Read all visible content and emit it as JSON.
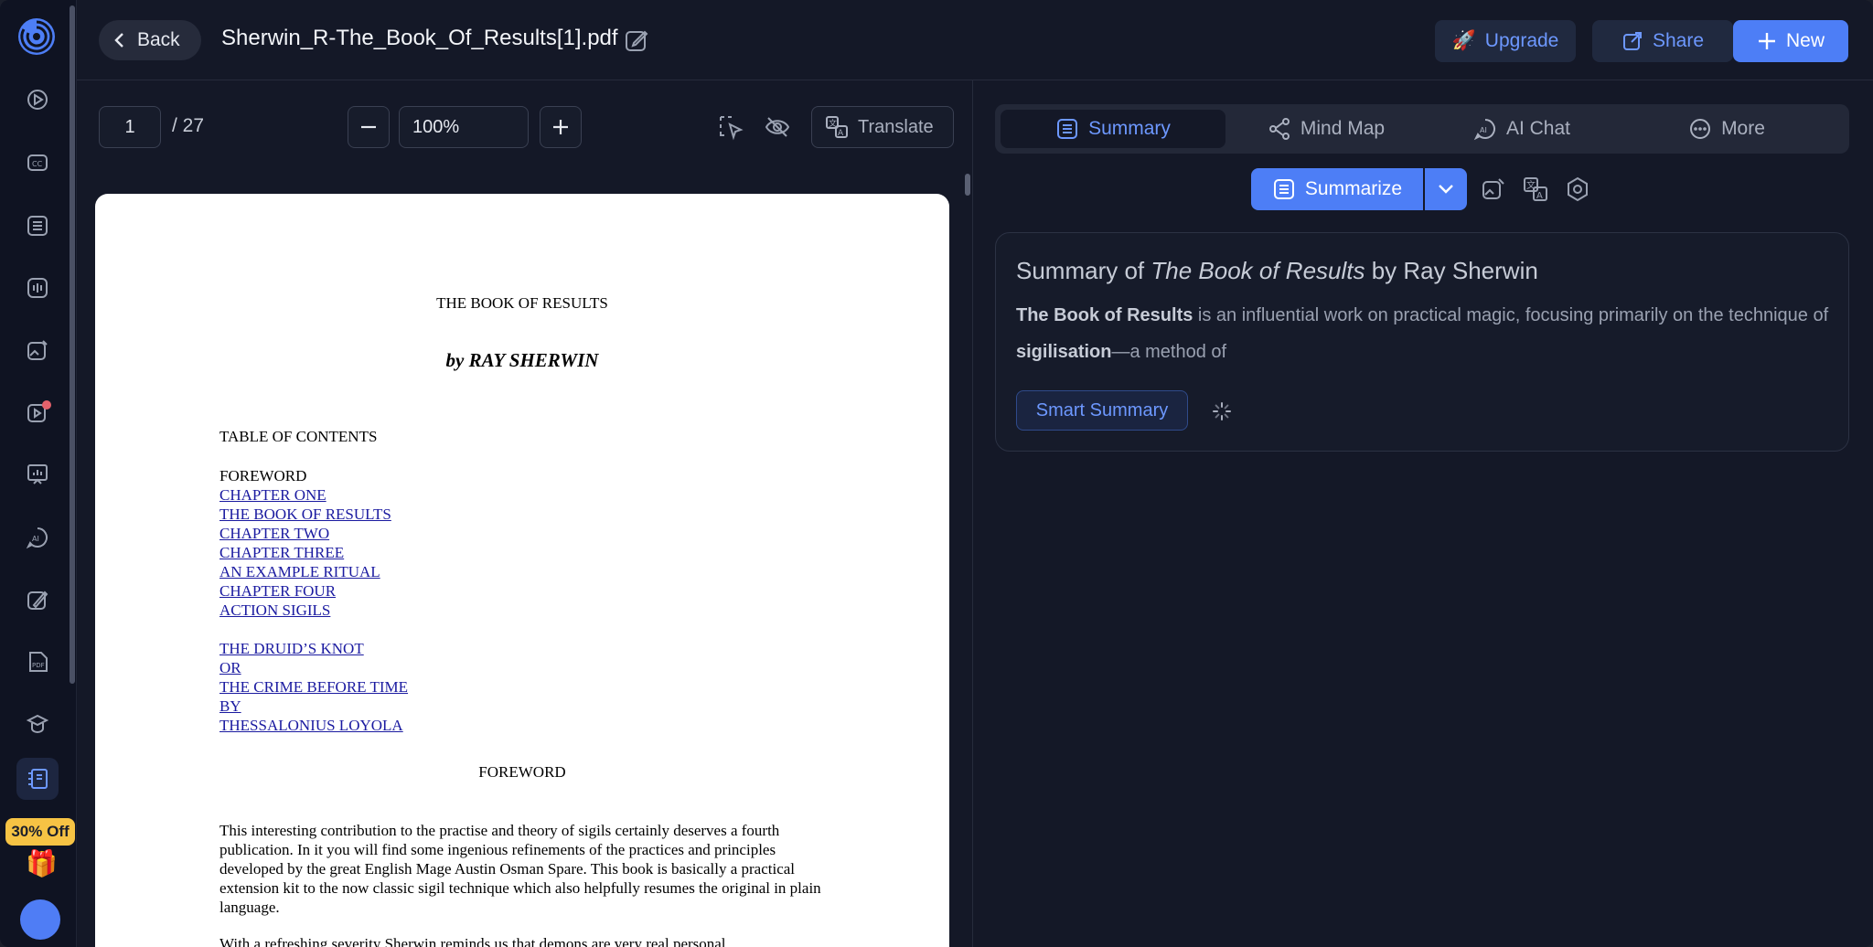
{
  "header": {
    "back_label": "Back",
    "doc_title": "Sherwin_R-The_Book_Of_Results[1].pdf",
    "upgrade_label": "Upgrade",
    "share_label": "Share",
    "new_label": "New"
  },
  "sidebar": {
    "promo_label": "30% Off",
    "items": [
      {
        "icon": "video-icon"
      },
      {
        "icon": "captions-icon"
      },
      {
        "icon": "list-icon"
      },
      {
        "icon": "audio-wave-icon"
      },
      {
        "icon": "image-edit-icon"
      },
      {
        "icon": "video-ai-icon"
      },
      {
        "icon": "presentation-icon"
      },
      {
        "icon": "ai-chat-icon"
      },
      {
        "icon": "pen-icon"
      },
      {
        "icon": "pdf-icon"
      },
      {
        "icon": "graduation-icon"
      },
      {
        "icon": "book-icon"
      }
    ]
  },
  "pdf_toolbar": {
    "page_current": "1",
    "page_total": "/ 27",
    "zoom": "100%",
    "translate_label": "Translate"
  },
  "pdf_page": {
    "title": "THE BOOK OF RESULTS",
    "byline": "by RAY SHERWIN",
    "toc_heading": "TABLE OF CONTENTS",
    "toc_plain": "FOREWORD",
    "toc_links_1": [
      "CHAPTER ONE",
      "THE BOOK OF RESULTS",
      "CHAPTER TWO",
      "CHAPTER THREE",
      "AN EXAMPLE RITUAL",
      "CHAPTER FOUR",
      "ACTION SIGILS"
    ],
    "toc_links_2": [
      "THE DRUID’S KNOT ",
      "OR ",
      "THE CRIME BEFORE TIME ",
      "BY ",
      "THESSALONIUS LOYOLA"
    ],
    "foreword_heading": "FOREWORD",
    "para1": "This interesting contribution to the practise and theory of sigils certainly deserves a fourth publication. In it you will find some ingenious refinements of the practices and principles developed by the great English Mage Austin Osman Spare. This book is basically a practical extension kit to the now classic sigil technique which also helpfully resumes the original in plain language.",
    "para2": "With a refreshing severity Sherwin reminds us that demons are very real personal"
  },
  "right_panel": {
    "tabs": [
      {
        "label": "Summary",
        "icon": "list-icon",
        "active": true
      },
      {
        "label": "Mind Map",
        "icon": "mind-map-icon",
        "active": false
      },
      {
        "label": "AI Chat",
        "icon": "ai-chat-icon",
        "active": false
      },
      {
        "label": "More",
        "icon": "more-icon",
        "active": false
      }
    ],
    "summarize_label": "Summarize",
    "card": {
      "title_prefix": "Summary of ",
      "title_italic": "The Book of Results",
      "title_suffix": " by Ray Sherwin",
      "body_bold1": "The Book of Results",
      "body_text1": " is an influential work on practical magic, focusing primarily on the technique of ",
      "body_bold2": "sigilisation",
      "body_text2": "—a method of",
      "smart_summary_label": "Smart Summary"
    }
  },
  "colors": {
    "accent": "#4d7ef6",
    "accent_text": "#6d98ff",
    "background": "#141827",
    "promo": "#f6c344"
  }
}
